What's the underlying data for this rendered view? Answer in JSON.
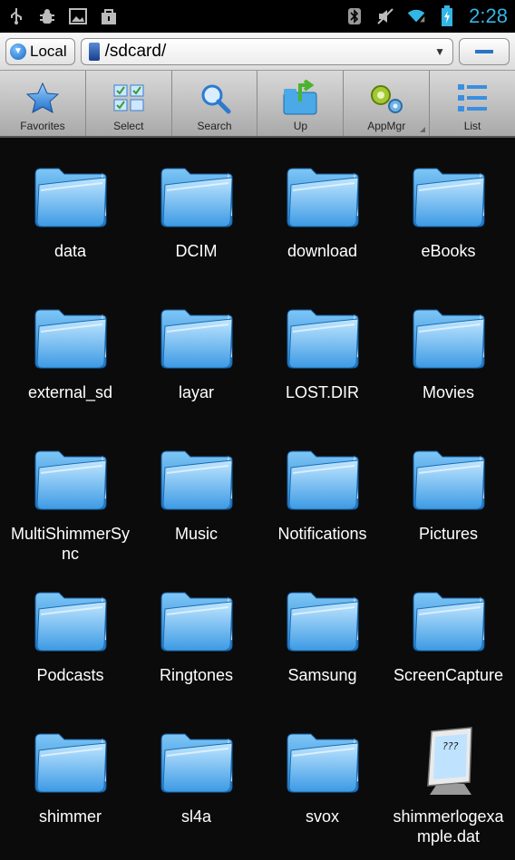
{
  "status_bar": {
    "left_icons": [
      "usb-icon",
      "debug-icon",
      "gallery-icon",
      "bag-icon"
    ],
    "right_icons": [
      "bluetooth-icon",
      "mute-icon",
      "wifi-icon",
      "battery-icon"
    ],
    "time": "2:28"
  },
  "path_bar": {
    "location_label": "Local",
    "path": "/sdcard/"
  },
  "toolbar": {
    "items": [
      {
        "label": "Favorites",
        "icon": "star-icon"
      },
      {
        "label": "Select",
        "icon": "select-grid-icon"
      },
      {
        "label": "Search",
        "icon": "search-icon"
      },
      {
        "label": "Up",
        "icon": "folder-up-icon"
      },
      {
        "label": "AppMgr",
        "icon": "gears-icon"
      },
      {
        "label": "List",
        "icon": "list-icon"
      }
    ]
  },
  "files": [
    {
      "name": "data",
      "type": "folder"
    },
    {
      "name": "DCIM",
      "type": "folder"
    },
    {
      "name": "download",
      "type": "folder"
    },
    {
      "name": "eBooks",
      "type": "folder"
    },
    {
      "name": "external_sd",
      "type": "folder"
    },
    {
      "name": "layar",
      "type": "folder"
    },
    {
      "name": "LOST.DIR",
      "type": "folder"
    },
    {
      "name": "Movies",
      "type": "folder"
    },
    {
      "name": "MultiShimmerSync",
      "type": "folder"
    },
    {
      "name": "Music",
      "type": "folder"
    },
    {
      "name": "Notifications",
      "type": "folder"
    },
    {
      "name": "Pictures",
      "type": "folder"
    },
    {
      "name": "Podcasts",
      "type": "folder"
    },
    {
      "name": "Ringtones",
      "type": "folder"
    },
    {
      "name": "Samsung",
      "type": "folder"
    },
    {
      "name": "ScreenCapture",
      "type": "folder"
    },
    {
      "name": "shimmer",
      "type": "folder"
    },
    {
      "name": "sl4a",
      "type": "folder"
    },
    {
      "name": "svox",
      "type": "folder"
    },
    {
      "name": "shimmerlogexample.dat",
      "type": "file",
      "file_icon_text": "???"
    }
  ]
}
